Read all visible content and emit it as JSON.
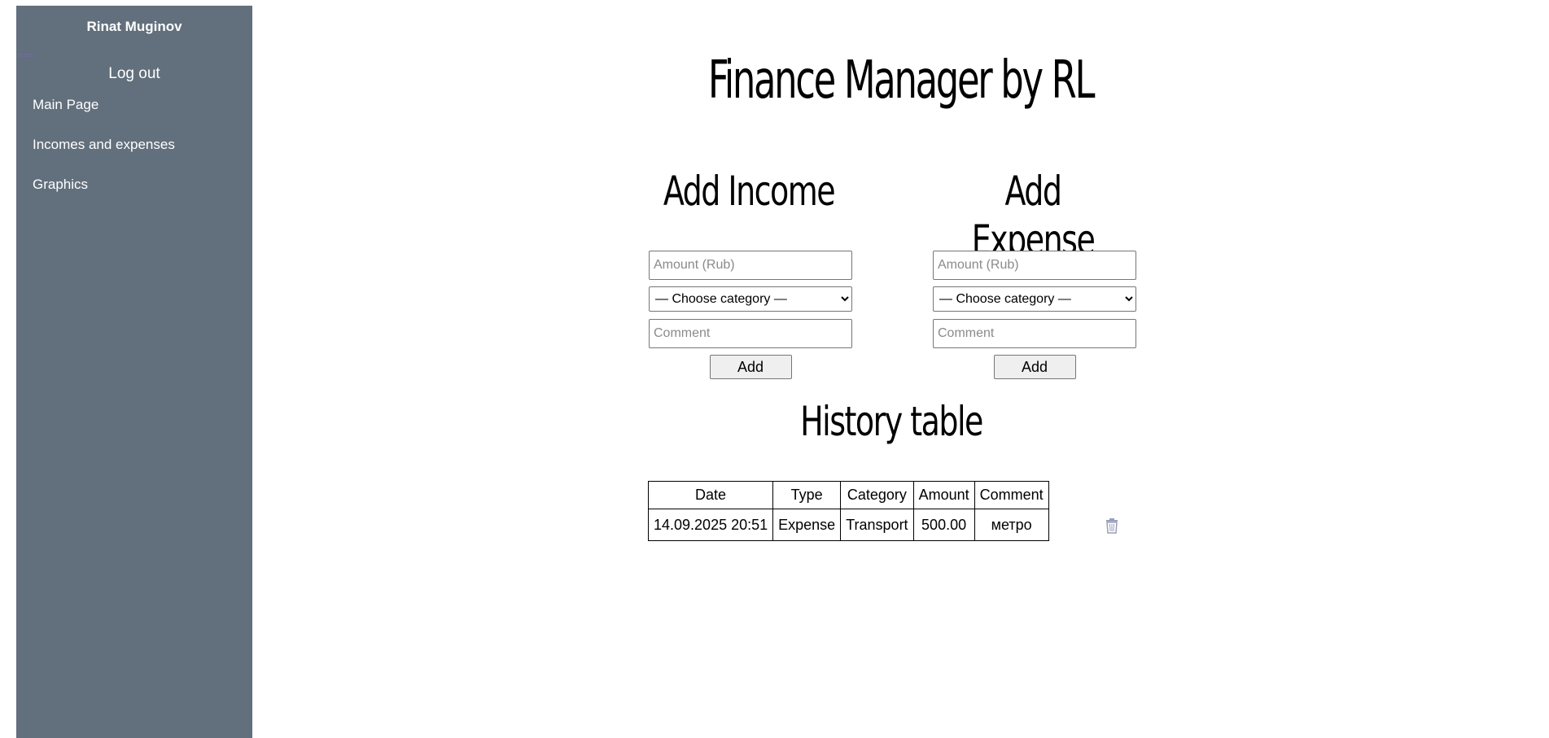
{
  "sidebar": {
    "username": "Rinat Muginov",
    "logout_label": "Log out",
    "items": [
      {
        "label": "Main Page"
      },
      {
        "label": "Incomes and expenses"
      },
      {
        "label": "Graphics"
      }
    ]
  },
  "main": {
    "title": "Finance Manager by RL"
  },
  "income_form": {
    "title": "Add Income",
    "amount_placeholder": "Amount (Rub)",
    "category_selected": "— Choose category —",
    "comment_placeholder": "Comment",
    "add_label": "Add"
  },
  "expense_form": {
    "title": "Add Expense",
    "amount_placeholder": "Amount (Rub)",
    "category_selected": "— Choose category —",
    "comment_placeholder": "Comment",
    "add_label": "Add"
  },
  "history": {
    "title": "History table",
    "columns": [
      "Date",
      "Type",
      "Category",
      "Amount",
      "Comment"
    ],
    "rows": [
      {
        "date": "14.09.2025 20:51",
        "type": "Expense",
        "category": "Transport",
        "amount": "500.00",
        "comment": "метро"
      }
    ]
  },
  "colors": {
    "sidebar_bg": "#626f7c",
    "trash_icon": "#9a9fb8"
  },
  "icons": {
    "row_delete": "trash-icon"
  }
}
